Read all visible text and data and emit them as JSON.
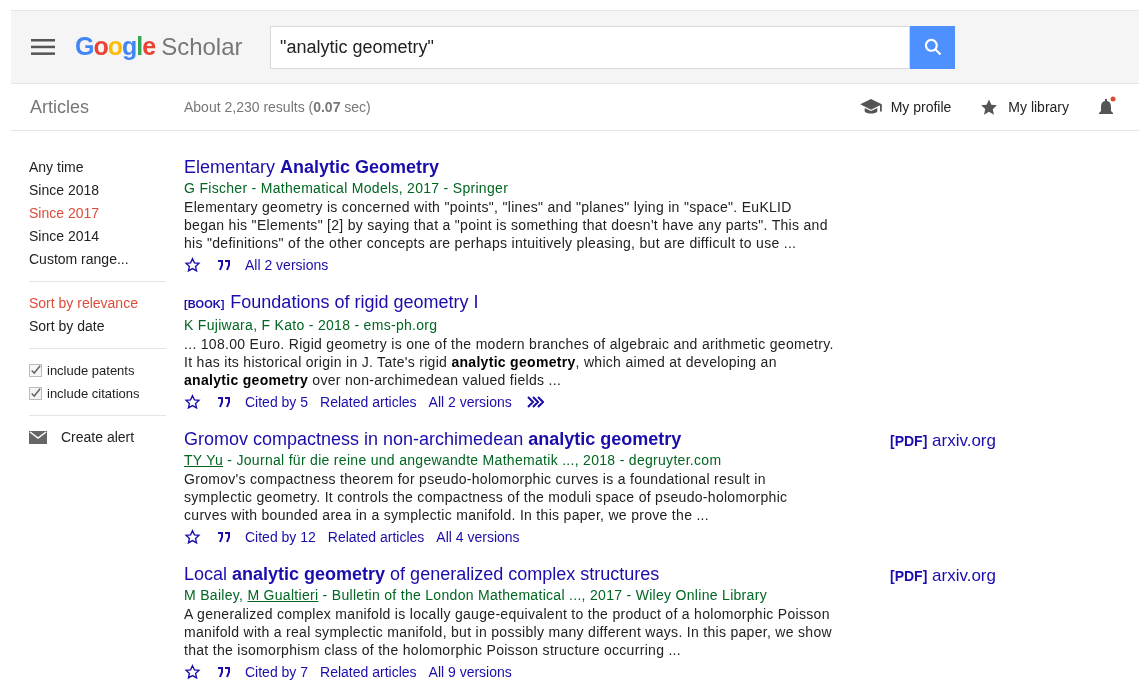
{
  "header": {
    "logo": {
      "part_1": "Google",
      "part_2": "Scholar"
    },
    "search": {
      "value": "\"analytic geometry\""
    }
  },
  "navbar": {
    "section": "Articles",
    "result_stats": "About 2,230 results (**0.07** sec)",
    "links": [
      {
        "kind": "profile",
        "label": "My profile"
      },
      {
        "kind": "library",
        "label": "My library"
      }
    ],
    "notification": true
  },
  "sidebar": {
    "time_filters": [
      {
        "label": "Any time",
        "selected": false
      },
      {
        "label": "Since 2018",
        "selected": false
      },
      {
        "label": "Since 2017",
        "selected": true
      },
      {
        "label": "Since 2014",
        "selected": false
      },
      {
        "label": "Custom range...",
        "selected": false
      }
    ],
    "sort": [
      {
        "label": "Sort by relevance",
        "selected": true
      },
      {
        "label": "Sort by date",
        "selected": false
      }
    ],
    "options": [
      {
        "label": "include patents",
        "checked": true
      },
      {
        "label": "include citations",
        "checked": true
      }
    ],
    "alert": "Create alert"
  },
  "results": [
    {
      "title": "Elementary **Analytic Geometry**",
      "authors": [
        {
          "text": "G Fischer",
          "linked": false
        },
        {
          "text": " - Mathematical Models, 2017 - Springer",
          "linked": false
        }
      ],
      "snippet": "Elementary geometry is concerned with \"points\", \"lines\" and \"planes\" lying in \"space\". EuKLID began his \"Elements\" [2] by saying that a \"point is something that doesn't have any parts\". This and his \"definitions\" of the other concepts are perhaps intuitively pleasing, but are difficult to use ...",
      "links": [
        "All 2 versions"
      ],
      "more": false
    },
    {
      "type": "[BOOK]",
      "title": "Foundations of rigid geometry I",
      "authors": [
        {
          "text": "K Fujiwara, F Kato - 2018 - ems-ph.org",
          "linked": false
        }
      ],
      "snippet": "... 108.00 Euro. Rigid geometry is one of the modern branches of algebraic and arithmetic geometry. It has its historical origin in J. Tate's rigid **analytic geometry**, which aimed at developing an **analytic geometry** over non-archimedean valued fields ...",
      "links": [
        "Cited by 5",
        "Related articles",
        "All 2 versions"
      ],
      "more": true
    },
    {
      "title": "Gromov compactness in non-archimedean **analytic geometry**",
      "authors": [
        {
          "text": "TY Yu",
          "linked": true
        },
        {
          "text": " - Journal für die reine und angewandte Mathematik ..., 2018 - degruyter.com",
          "linked": false
        }
      ],
      "snippet": "Gromov's compactness theorem for pseudo-holomorphic curves is a foundational result in symplectic geometry. It controls the compactness of the moduli space of pseudo-holomorphic curves with bounded area in a symplectic manifold. In this paper, we prove the ...",
      "links": [
        "Cited by 12",
        "Related articles",
        "All 4 versions"
      ],
      "more": false,
      "pdf": {
        "tag": "[PDF]",
        "source": "arxiv.org"
      }
    },
    {
      "title": "Local **analytic geometry** of generalized complex structures",
      "authors": [
        {
          "text": "M Bailey, ",
          "linked": false
        },
        {
          "text": "M Gualtieri",
          "linked": true
        },
        {
          "text": " - Bulletin of the London Mathematical ..., 2017 - Wiley Online Library",
          "linked": false
        }
      ],
      "snippet": "A generalized complex manifold is locally gauge-equivalent to the product of a holomorphic Poisson manifold with a real symplectic manifold, but in possibly many different ways. In this paper, we show that the isomorphism class of the holomorphic Poisson structure occurring ...",
      "links": [
        "Cited by 7",
        "Related articles",
        "All 9 versions"
      ],
      "more": false,
      "pdf": {
        "tag": "[PDF]",
        "source": "arxiv.org"
      }
    }
  ]
}
